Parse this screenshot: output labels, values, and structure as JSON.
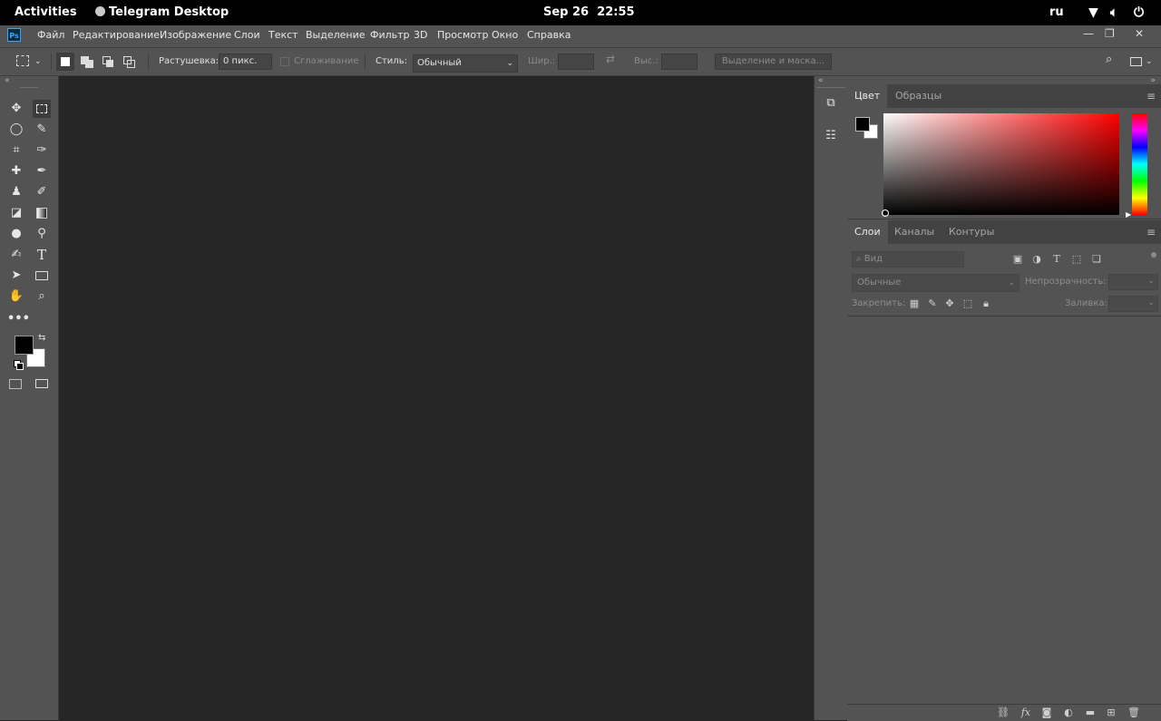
{
  "system_bar": {
    "activities": "Activities",
    "app_name": "Telegram Desktop",
    "date": "Sep 26",
    "time": "22:55",
    "language": "ru"
  },
  "app": {
    "logo": "Ps",
    "menu": [
      "Файл",
      "Редактирование",
      "Изображение",
      "Слои",
      "Текст",
      "Выделение",
      "Фильтр",
      "3D",
      "Просмотр",
      "Окно",
      "Справка"
    ],
    "window_controls": [
      "—",
      "❐",
      "✕"
    ]
  },
  "options_bar": {
    "feather_label": "Растушевка:",
    "feather_value": "0 пикс.",
    "antialias_label": "Сглаживание",
    "style_label": "Стиль:",
    "style_value": "Обычный",
    "width_label": "Шир.:",
    "height_label": "Выс.:",
    "select_mask_button": "Выделение и маска..."
  },
  "color_panel": {
    "tabs": [
      "Цвет",
      "Образцы"
    ],
    "foreground": "#000000",
    "background": "#ffffff",
    "hue_color": "#ff0000"
  },
  "layers_panel": {
    "tabs": [
      "Слои",
      "Каналы",
      "Контуры"
    ],
    "search_placeholder": "Вид",
    "blend_mode": "Обычные",
    "opacity_label": "Непрозрачность:",
    "lock_label": "Закрепить:",
    "fill_label": "Заливка:",
    "filter_icons": [
      "image-filter-icon",
      "adjustment-filter-icon",
      "type-filter-icon",
      "shape-filter-icon",
      "smart-object-filter-icon"
    ],
    "lock_icons": [
      "lock-transparent-icon",
      "lock-pixels-icon",
      "lock-position-icon",
      "lock-artboard-icon",
      "lock-all-icon"
    ],
    "footer_icons": [
      "link-layers-icon",
      "fx-icon",
      "add-mask-icon",
      "adjustment-layer-icon",
      "group-folder-icon",
      "new-layer-icon",
      "trash-icon"
    ]
  }
}
